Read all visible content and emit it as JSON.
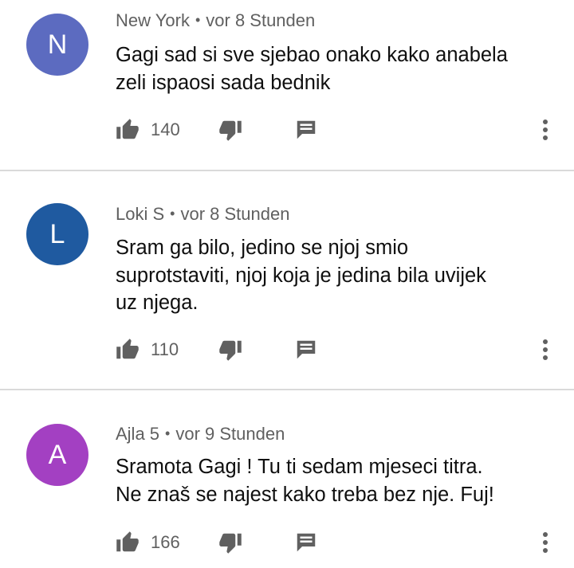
{
  "comments": [
    {
      "initial": "N",
      "avatar_color": "#5c6bc0",
      "author": "New York",
      "separator": "•",
      "time": "vor 8 Stunden",
      "lines": [
        "Gagi sad si sve sjebao onako kako anabela",
        "zeli ispaosi sada bednik"
      ],
      "likes": "140"
    },
    {
      "initial": "L",
      "avatar_color": "#1f5aa0",
      "author": "Loki S",
      "separator": "•",
      "time": "vor 8 Stunden",
      "lines": [
        "Sram ga bilo, jedino se njoj smio",
        "suprotstaviti, njoj koja je jedina bila uvijek",
        "uz njega."
      ],
      "likes": "110"
    },
    {
      "initial": "A",
      "avatar_color": "#a340c2",
      "author": "Ajla 5",
      "separator": "•",
      "time": "vor 9 Stunden",
      "lines": [
        "Sramota Gagi ! Tu ti sedam mjeseci titra.",
        "Ne znaš se najest kako treba bez nje. Fuj!"
      ],
      "likes": "166"
    }
  ],
  "icons": {
    "like": "thumb-up-icon",
    "dislike": "thumb-down-icon",
    "reply": "reply-icon",
    "more": "more-vert-icon"
  },
  "colors": {
    "icon": "#606060",
    "divider": "#dadada",
    "meta_text": "#606060"
  }
}
